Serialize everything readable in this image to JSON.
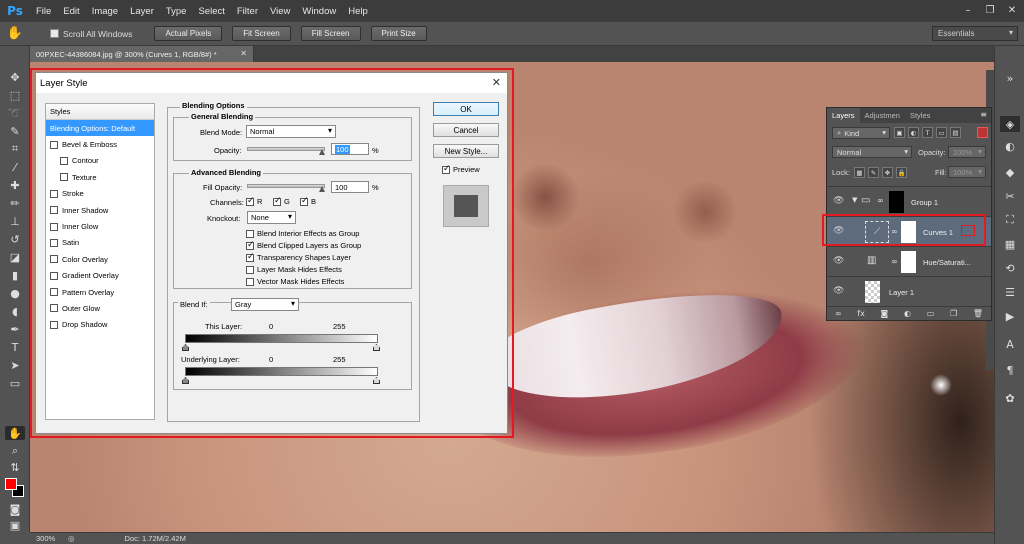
{
  "app": {
    "logo": "Ps"
  },
  "menubar": {
    "items": [
      "File",
      "Edit",
      "Image",
      "Layer",
      "Type",
      "Select",
      "Filter",
      "View",
      "Window",
      "Help"
    ]
  },
  "window_controls": {
    "minimize": "–",
    "restore": "❐",
    "close": "✕"
  },
  "options_bar": {
    "scroll_all_windows_label": "Scroll All Windows",
    "scroll_all_windows_checked": false,
    "buttons": [
      "Actual Pixels",
      "Fit Screen",
      "Fill Screen",
      "Print Size"
    ],
    "workspace": "Essentials"
  },
  "document": {
    "tab_title": "00PXEC-44386084.jpg @ 300% (Curves 1, RGB/8#) *",
    "zoom": "300%",
    "doc_info": "Doc: 1.72M/2.42M"
  },
  "colors": {
    "foreground": "#ff0000",
    "background": "#000000",
    "highlight": "#e21b23",
    "selection": "#3399ff"
  },
  "dialog": {
    "title": "Layer Style",
    "styles_header": "Styles",
    "styles": [
      {
        "label": "Blending Options: Default",
        "selected": true,
        "checkbox": false,
        "indent": false
      },
      {
        "label": "Bevel & Emboss",
        "selected": false,
        "checkbox": true,
        "indent": false
      },
      {
        "label": "Contour",
        "selected": false,
        "checkbox": true,
        "indent": true
      },
      {
        "label": "Texture",
        "selected": false,
        "checkbox": true,
        "indent": true
      },
      {
        "label": "Stroke",
        "selected": false,
        "checkbox": true,
        "indent": false
      },
      {
        "label": "Inner Shadow",
        "selected": false,
        "checkbox": true,
        "indent": false
      },
      {
        "label": "Inner Glow",
        "selected": false,
        "checkbox": true,
        "indent": false
      },
      {
        "label": "Satin",
        "selected": false,
        "checkbox": true,
        "indent": false
      },
      {
        "label": "Color Overlay",
        "selected": false,
        "checkbox": true,
        "indent": false
      },
      {
        "label": "Gradient Overlay",
        "selected": false,
        "checkbox": true,
        "indent": false
      },
      {
        "label": "Pattern Overlay",
        "selected": false,
        "checkbox": true,
        "indent": false
      },
      {
        "label": "Outer Glow",
        "selected": false,
        "checkbox": true,
        "indent": false
      },
      {
        "label": "Drop Shadow",
        "selected": false,
        "checkbox": true,
        "indent": false
      }
    ],
    "blending_options": {
      "heading": "Blending Options",
      "general": {
        "title": "General Blending",
        "blend_mode_label": "Blend Mode:",
        "blend_mode": "Normal",
        "opacity_label": "Opacity:",
        "opacity": "100",
        "opacity_unit": "%"
      },
      "advanced": {
        "title": "Advanced Blending",
        "fill_opacity_label": "Fill Opacity:",
        "fill_opacity": "100",
        "fill_opacity_unit": "%",
        "channels_label": "Channels:",
        "channels": [
          {
            "label": "R",
            "checked": true
          },
          {
            "label": "G",
            "checked": true
          },
          {
            "label": "B",
            "checked": true
          }
        ],
        "knockout_label": "Knockout:",
        "knockout": "None",
        "options": [
          {
            "label": "Blend Interior Effects as Group",
            "checked": false
          },
          {
            "label": "Blend Clipped Layers as Group",
            "checked": true
          },
          {
            "label": "Transparency Shapes Layer",
            "checked": true
          },
          {
            "label": "Layer Mask Hides Effects",
            "checked": false
          },
          {
            "label": "Vector Mask Hides Effects",
            "checked": false
          }
        ]
      },
      "blend_if": {
        "label": "Blend If:",
        "value": "Gray",
        "this_layer_label": "This Layer:",
        "this_layer_min": "0",
        "this_layer_max": "255",
        "underlying_label": "Underlying Layer:",
        "underlying_min": "0",
        "underlying_max": "255"
      }
    },
    "buttons": {
      "ok": "OK",
      "cancel": "Cancel",
      "new_style": "New Style..."
    },
    "preview_label": "Preview",
    "preview_checked": true
  },
  "layers_panel": {
    "tabs": [
      "Layers",
      "Adjustmen",
      "Styles"
    ],
    "kind_label": "Kind",
    "blend_mode": "Normal",
    "opacity_label": "Opacity:",
    "opacity": "100%",
    "lock_label": "Lock:",
    "fill_label": "Fill:",
    "fill": "100%",
    "layers": [
      {
        "name": "Group 1",
        "selected": false
      },
      {
        "name": "Curves 1",
        "selected": true
      },
      {
        "name": "Hue/Saturati...",
        "selected": false
      },
      {
        "name": "Layer 1",
        "selected": false
      }
    ]
  }
}
